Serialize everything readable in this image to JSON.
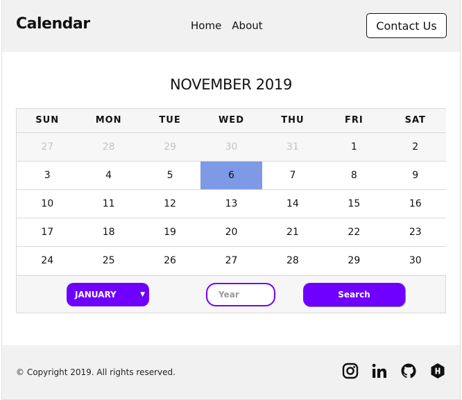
{
  "header": {
    "brand": "Calendar",
    "nav": [
      "Home",
      "About"
    ],
    "contact_label": "Contact Us"
  },
  "calendar": {
    "title": "NOVEMBER 2019",
    "weekdays": [
      "SUN",
      "MON",
      "TUE",
      "WED",
      "THU",
      "FRI",
      "SAT"
    ],
    "weeks": [
      [
        "27",
        "28",
        "29",
        "30",
        "31",
        "1",
        "2"
      ],
      [
        "3",
        "4",
        "5",
        "6",
        "7",
        "8",
        "9"
      ],
      [
        "10",
        "11",
        "12",
        "13",
        "14",
        "15",
        "16"
      ],
      [
        "17",
        "18",
        "19",
        "20",
        "21",
        "22",
        "23"
      ],
      [
        "24",
        "25",
        "26",
        "27",
        "28",
        "29",
        "30"
      ]
    ],
    "faded_first_row_count": 5,
    "selected_day": "6",
    "selected_color": "#7e9ae6"
  },
  "controls": {
    "month_selected": "JANUARY",
    "year_placeholder": "Year",
    "search_label": "Search",
    "accent_color": "#6f00ff"
  },
  "footer": {
    "copyright": "© Copyright 2019. All rights reserved.",
    "social_icons": [
      "instagram-icon",
      "linkedin-icon",
      "github-icon",
      "hashnode-icon"
    ]
  }
}
